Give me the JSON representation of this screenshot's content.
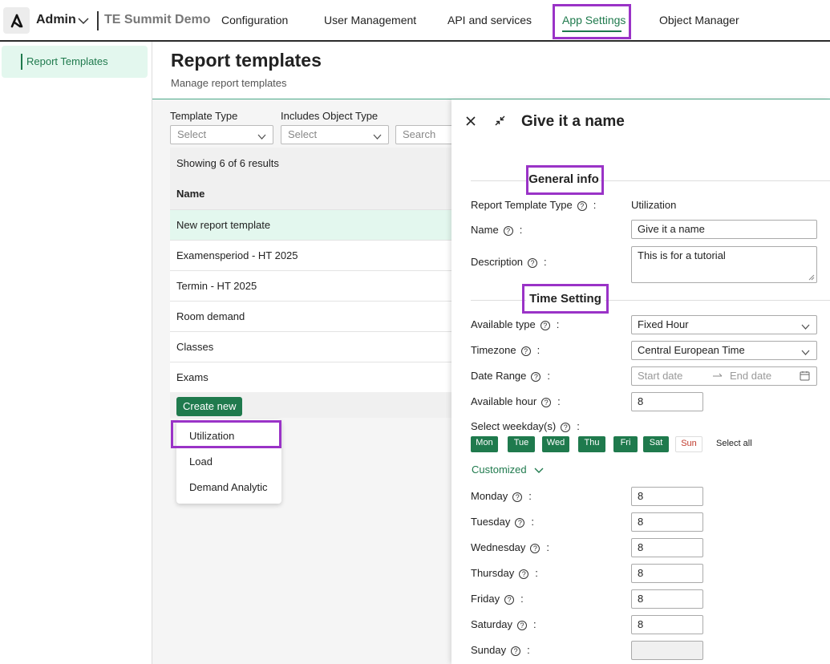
{
  "topbar": {
    "admin_label": "Admin",
    "tenant": "TE Summit Demo",
    "nav": [
      "Configuration",
      "User Management",
      "API and services",
      "App Settings",
      "Object Manager"
    ],
    "active_nav": "App Settings"
  },
  "sidebar": {
    "items": [
      {
        "label": "Report Templates",
        "active": true
      }
    ]
  },
  "page": {
    "title": "Report templates",
    "subtitle": "Manage report templates"
  },
  "filters": {
    "template_type_label": "Template Type",
    "template_type_value": "Select",
    "object_type_label": "Includes Object Type",
    "object_type_value": "Select",
    "search_placeholder": "Search"
  },
  "results": {
    "showing": "Showing 6 of 6 results",
    "column_name": "Name",
    "rows": [
      "New report template",
      "Examensperiod - HT 2025",
      "Termin - HT 2025",
      "Room demand",
      "Classes",
      "Exams"
    ],
    "selected_row": "New report template",
    "create_label": "Create new"
  },
  "create_menu": {
    "items": [
      "Utilization",
      "Load",
      "Demand Analytic"
    ],
    "highlighted": "Utilization"
  },
  "panel": {
    "title": "Give it a name",
    "general_info": "General info",
    "report_type_label": "Report Template Type",
    "report_type_value": "Utilization",
    "name_label": "Name",
    "name_value": "Give it a name",
    "description_label": "Description",
    "description_value": "This is for a tutorial",
    "time_setting": "Time Setting",
    "available_type_label": "Available type",
    "available_type_value": "Fixed Hour",
    "timezone_label": "Timezone",
    "timezone_value": "Central European Time",
    "date_range_label": "Date Range",
    "start_placeholder": "Start date",
    "end_placeholder": "End date",
    "available_hour_label": "Available hour",
    "available_hour_value": "8",
    "weekday_label": "Select weekday(s)",
    "weekdays": [
      {
        "label": "Mon",
        "selected": true
      },
      {
        "label": "Tue",
        "selected": true
      },
      {
        "label": "Wed",
        "selected": true
      },
      {
        "label": "Thu",
        "selected": true
      },
      {
        "label": "Fri",
        "selected": true
      },
      {
        "label": "Sat",
        "selected": true
      },
      {
        "label": "Sun",
        "selected": false
      }
    ],
    "select_all": "Select all",
    "customized": "Customized",
    "days": [
      {
        "label": "Monday",
        "value": "8"
      },
      {
        "label": "Tuesday",
        "value": "8"
      },
      {
        "label": "Wednesday",
        "value": "8"
      },
      {
        "label": "Thursday",
        "value": "8"
      },
      {
        "label": "Friday",
        "value": "8"
      },
      {
        "label": "Saturday",
        "value": "8"
      },
      {
        "label": "Sunday",
        "value": ""
      }
    ]
  },
  "colors": {
    "accent": "#1f7a4d",
    "highlight": "#9a33c7",
    "selected_bg": "#e3f7ee"
  }
}
